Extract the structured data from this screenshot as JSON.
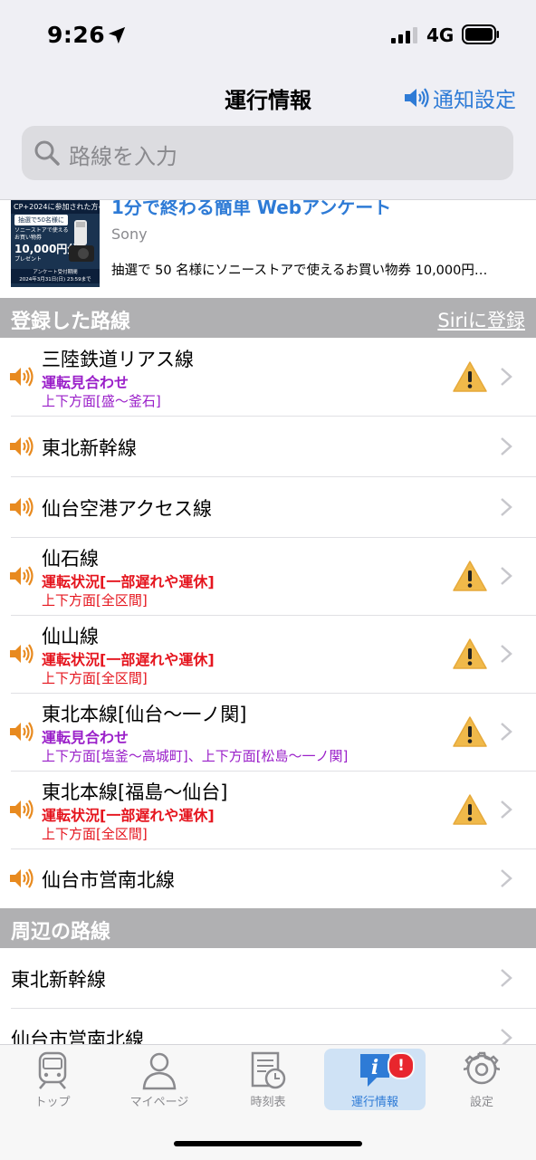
{
  "status_bar": {
    "time": "9:26",
    "network": "4G"
  },
  "nav": {
    "title": "運行情報",
    "notify_label": "通知設定"
  },
  "search": {
    "placeholder": "路線を入力"
  },
  "ad": {
    "headline": "1分で終わる簡単 Webアンケート",
    "brand": "Sony",
    "description": "抽選で 50 名様にソニーストアで使えるお買い物券 10,000円…",
    "thumb": {
      "top_text": "CP+2024に参加された方へ",
      "badge": "抽選で50名様に",
      "sub": "ソニーストアで使える お買い物券",
      "amount": "10,000円分",
      "present": "プレゼント",
      "deadline_1": "アンケート受付期間",
      "deadline_2": "2024年3月31日(日) 23:59まで"
    }
  },
  "registered": {
    "header": "登録した路線",
    "siri": "Siriに登録",
    "rows": [
      {
        "name": "三陸鉄道リアス線",
        "status": "運転見合わせ",
        "direction": "上下方面[盛〜釜石]",
        "color": "purple",
        "warn": true
      },
      {
        "name": "東北新幹線",
        "warn": false
      },
      {
        "name": "仙台空港アクセス線",
        "warn": false
      },
      {
        "name": "仙石線",
        "status": "運転状況[一部遅れや運休]",
        "direction": "上下方面[全区間]",
        "color": "red",
        "warn": true
      },
      {
        "name": "仙山線",
        "status": "運転状況[一部遅れや運休]",
        "direction": "上下方面[全区間]",
        "color": "red",
        "warn": true
      },
      {
        "name": "東北本線[仙台〜一ノ関]",
        "status": "運転見合わせ",
        "direction": "上下方面[塩釜〜高城町]、上下方面[松島〜一ノ関]",
        "color": "purple",
        "warn": true
      },
      {
        "name": "東北本線[福島〜仙台]",
        "status": "運転状況[一部遅れや運休]",
        "direction": "上下方面[全区間]",
        "color": "red",
        "warn": true
      },
      {
        "name": "仙台市営南北線",
        "warn": false
      }
    ]
  },
  "nearby": {
    "header": "周辺の路線",
    "rows": [
      {
        "name": "東北新幹線"
      },
      {
        "name": "仙台市営南北線"
      }
    ]
  },
  "tabs": [
    {
      "label": "トップ"
    },
    {
      "label": "マイページ"
    },
    {
      "label": "時刻表"
    },
    {
      "label": "運行情報",
      "badge": "!"
    },
    {
      "label": "設定"
    }
  ],
  "colors": {
    "accent": "#2e7bd6",
    "purple": "#9a1fc9",
    "red": "#e5151e",
    "speaker": "#e88a1f",
    "warn": "#f0b94a"
  }
}
